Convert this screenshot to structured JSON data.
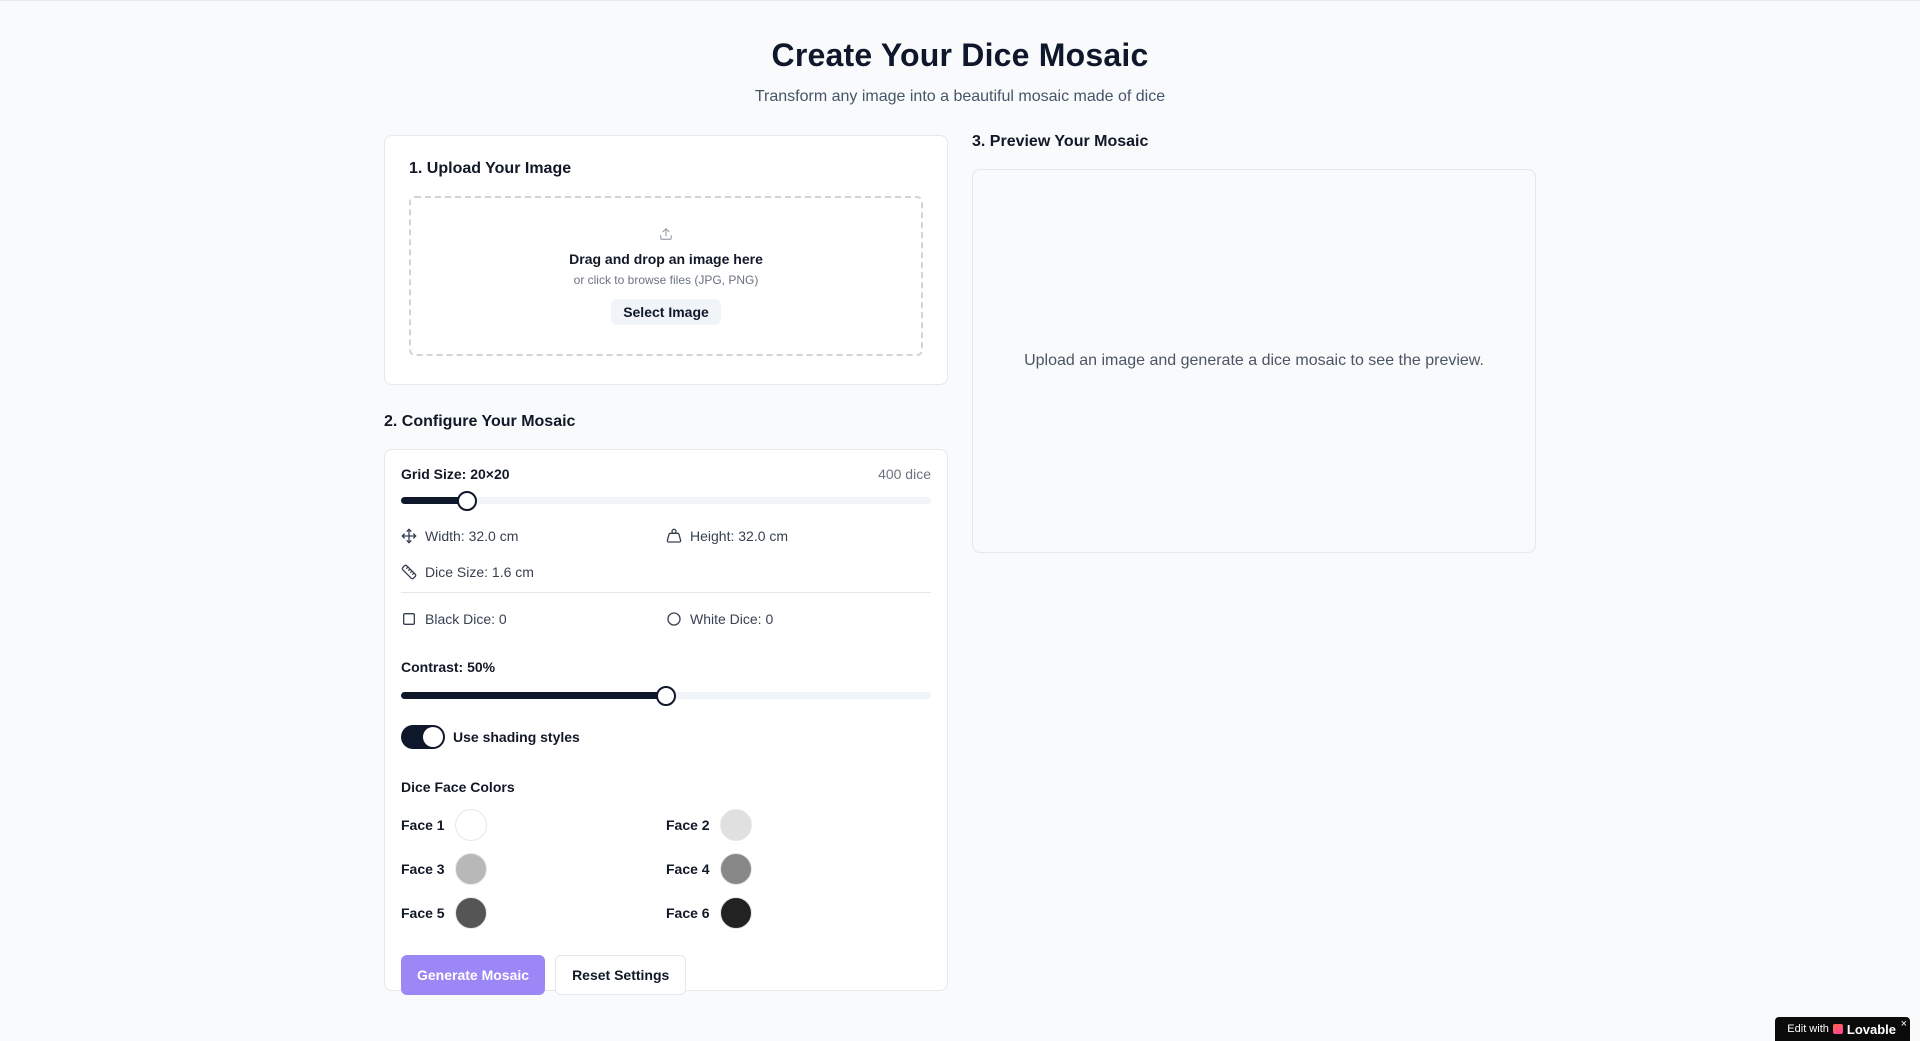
{
  "header": {
    "title": "Create Your Dice Mosaic",
    "subtitle": "Transform any image into a beautiful mosaic made of dice"
  },
  "upload": {
    "heading": "1. Upload Your Image",
    "drop_title": "Drag and drop an image here",
    "drop_sub": "or click to browse files (JPG, PNG)",
    "button": "Select Image"
  },
  "config": {
    "heading": "2. Configure Your Mosaic",
    "grid_label": "Grid Size: 20×20",
    "dice_count": "400 dice",
    "grid_slider_fraction": 0.125,
    "width": "Width: 32.0 cm",
    "height": "Height: 32.0 cm",
    "dice_size": "Dice Size: 1.6 cm",
    "black_dice": "Black Dice: 0",
    "white_dice": "White Dice: 0",
    "contrast_label": "Contrast: 50%",
    "contrast_value": 0.5,
    "shading_label": "Use shading styles",
    "shading_on": true,
    "colors_heading": "Dice Face Colors",
    "faces": [
      {
        "label": "Face 1",
        "color": "#ffffff"
      },
      {
        "label": "Face 2",
        "color": "#e0e0e0"
      },
      {
        "label": "Face 3",
        "color": "#b8b8b8"
      },
      {
        "label": "Face 4",
        "color": "#888888"
      },
      {
        "label": "Face 5",
        "color": "#555555"
      },
      {
        "label": "Face 6",
        "color": "#222222"
      }
    ],
    "generate_button": "Generate Mosaic",
    "reset_button": "Reset Settings"
  },
  "preview": {
    "heading": "3. Preview Your Mosaic",
    "placeholder": "Upload an image and generate a dice mosaic to see the preview."
  },
  "badge": {
    "prefix": "Edit with",
    "brand": "Lovable",
    "close": "×"
  },
  "colors": {
    "accent": "#9b87f5",
    "primary": "#0f172a"
  }
}
